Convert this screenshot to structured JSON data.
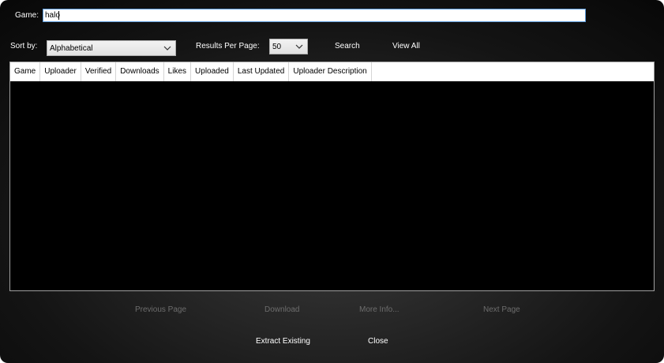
{
  "search": {
    "game_label": "Game:",
    "game_value": "halo",
    "sort_label": "Sort by:",
    "sort_value": "Alphabetical",
    "results_label": "Results Per Page:",
    "results_value": "50",
    "search_button": "Search",
    "view_all_button": "View All"
  },
  "table": {
    "columns": [
      "Game",
      "Uploader",
      "Verified",
      "Downloads",
      "Likes",
      "Uploaded",
      "Last Updated",
      "Uploader Description"
    ],
    "rows": []
  },
  "pager": {
    "previous": "Previous Page",
    "download": "Download",
    "more_info": "More Info...",
    "next": "Next Page"
  },
  "footer": {
    "extract": "Extract Existing",
    "close": "Close"
  },
  "colors": {
    "accent_border": "#5d9cdb",
    "disabled_text": "#6d6d6d"
  }
}
